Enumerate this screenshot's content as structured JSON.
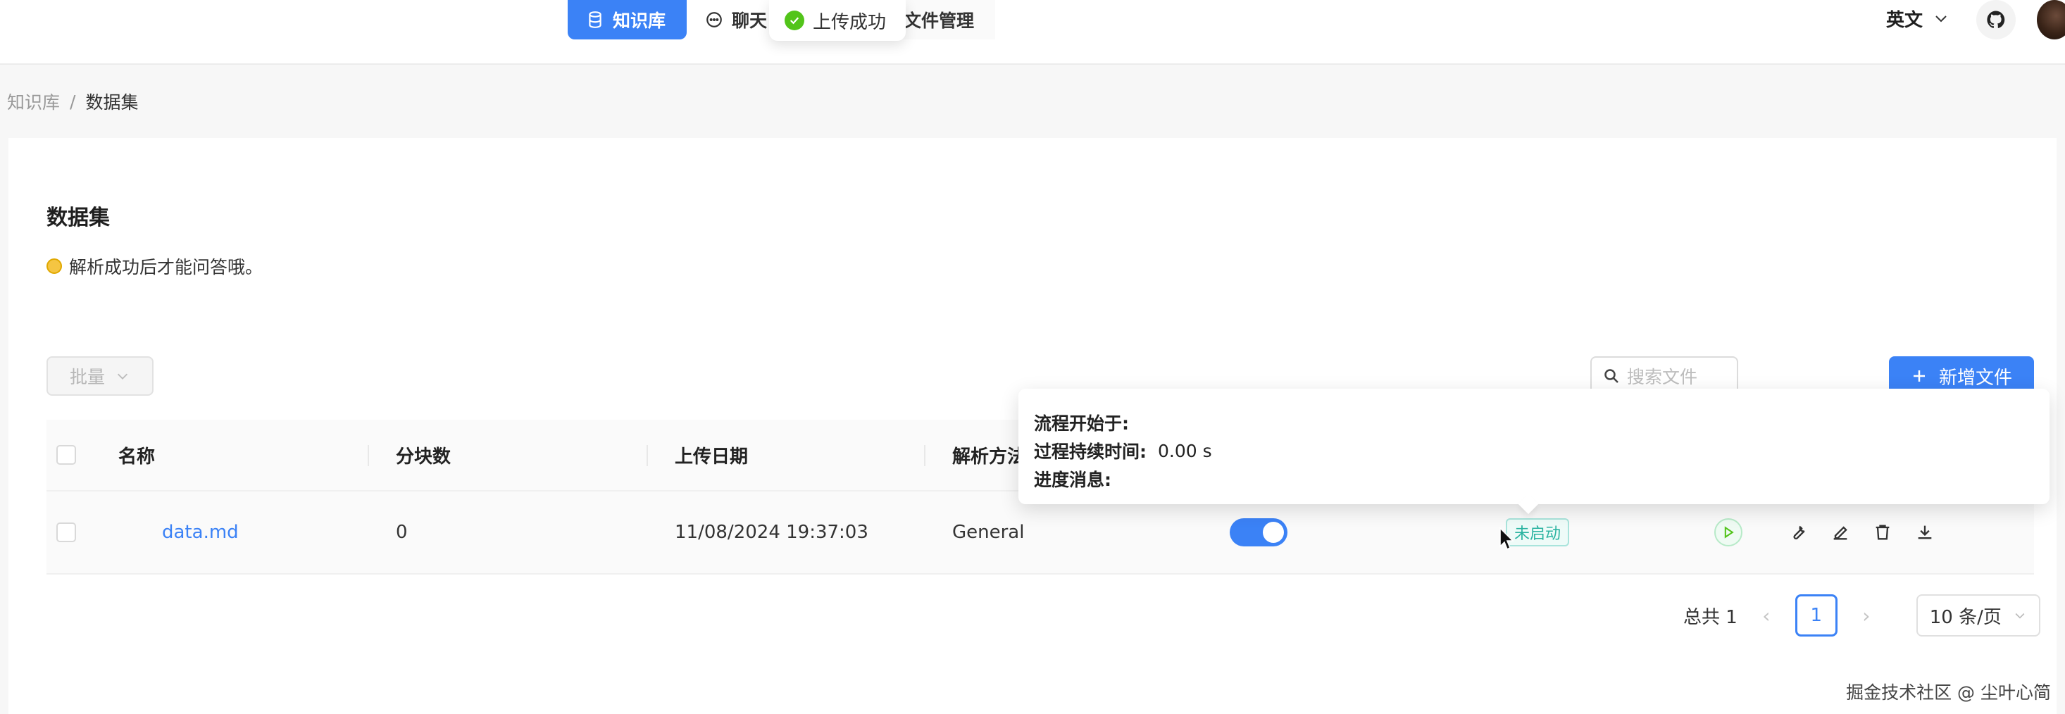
{
  "nav": {
    "tabs": [
      {
        "label": "知识库",
        "icon": "database-icon",
        "active": true
      },
      {
        "label": "聊天",
        "icon": "chat-icon",
        "active": false
      },
      {
        "label": "文件管理",
        "icon": "folder-icon",
        "active": false
      }
    ],
    "language": "英文"
  },
  "toast": {
    "message": "上传成功",
    "status_color": "#52c41a"
  },
  "breadcrumb": {
    "root": "知识库",
    "separator": "/",
    "current": "数据集"
  },
  "page": {
    "title": "数据集",
    "hint": "解析成功后才能问答哦。",
    "batch_label": "批量",
    "search_placeholder": "搜索文件",
    "add_label": "新增文件"
  },
  "table": {
    "headers": {
      "name": "名称",
      "chunks": "分块数",
      "upload_date": "上传日期",
      "parse_method": "解析方法"
    },
    "rows": [
      {
        "name": "data.md",
        "chunks": "0",
        "upload_date": "11/08/2024 19:37:03",
        "parse_method": "General",
        "enabled": true,
        "status": "未启动"
      }
    ]
  },
  "popover": {
    "start_label": "流程开始于:",
    "duration_label": "过程持续时间:",
    "duration_value": "0.00 s",
    "progress_label": "进度消息:"
  },
  "pagination": {
    "total_label": "总共 1",
    "current_page": "1",
    "page_size": "10 条/页"
  },
  "watermark": "掘金技术社区 @ 尘叶心简",
  "colors": {
    "accent": "#3b82f6",
    "success": "#52c41a",
    "tag": "#2ab3a0"
  }
}
